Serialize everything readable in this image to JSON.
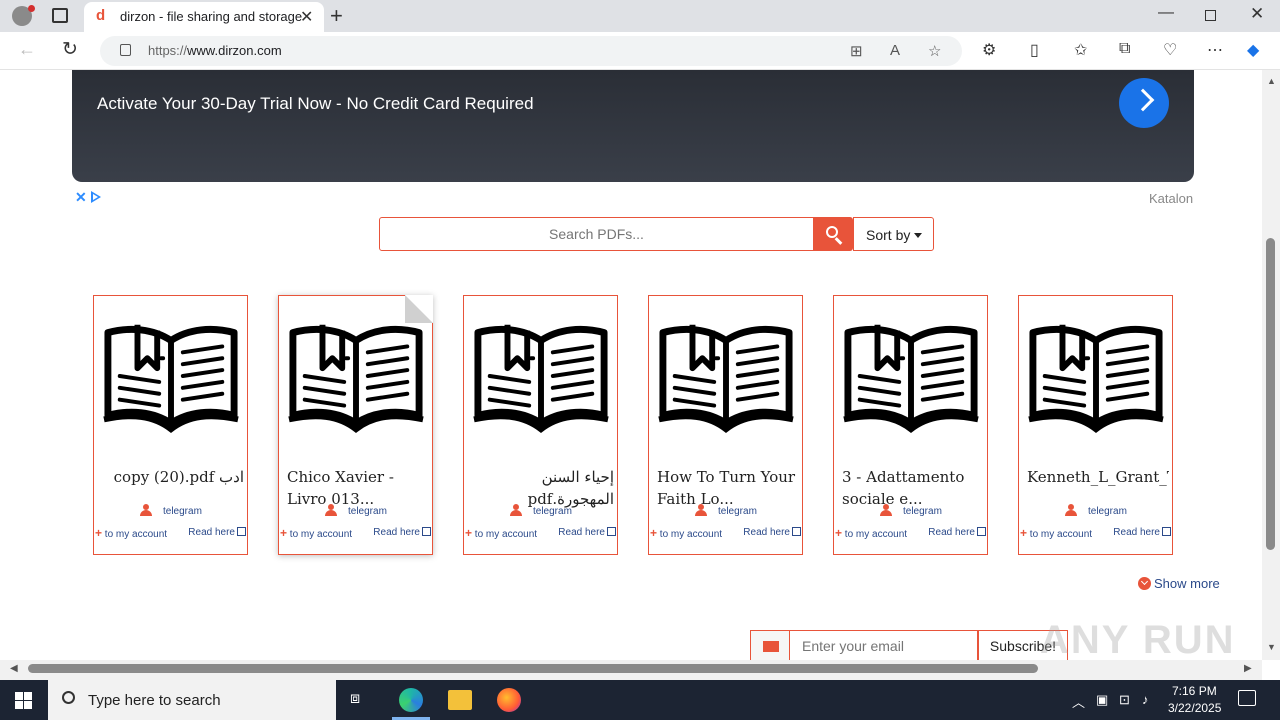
{
  "browser": {
    "tab_title": "dirzon - file sharing and storage",
    "favicon_letter": "d",
    "url_prefix": "https://",
    "url_host": "www.dirzon.com"
  },
  "ad": {
    "text": "Activate Your 30-Day Trial Now - No Credit Card Required",
    "brand": "Katalon",
    "close_glyph": "✕"
  },
  "search": {
    "placeholder": "Search PDFs...",
    "sort_label": "Sort by"
  },
  "cards": [
    {
      "title": "ادب copy (20).pdf",
      "author": "telegram",
      "add_label": "to my account",
      "read_label": "Read here"
    },
    {
      "title": "Chico Xavier - Livro 013...",
      "author": "telegram",
      "add_label": "to my account",
      "read_label": "Read here"
    },
    {
      "title": "إحياء السنن المهجورة.pdf",
      "author": "telegram",
      "add_label": "to my account",
      "read_label": "Read here"
    },
    {
      "title": "How To Turn Your Faith Lo...",
      "author": "telegram",
      "add_label": "to my account",
      "read_label": "Read here"
    },
    {
      "title": "3 - Adattamento sociale e...",
      "author": "telegram",
      "add_label": "to my account",
      "read_label": "Read here"
    },
    {
      "title": "Kenneth_L_Grant_Trading_R...",
      "author": "telegram",
      "add_label": "to my account",
      "read_label": "Read here"
    }
  ],
  "show_more": "Show more",
  "subscribe": {
    "placeholder": "Enter your email",
    "button": "Subscribe!"
  },
  "watermark": "ANY RUN",
  "taskbar": {
    "search_text": "Type here to search",
    "time": "7:16 PM",
    "date": "3/22/2025"
  },
  "colors": {
    "accent": "#e8543a",
    "link": "#2b4a8a",
    "ad_cta": "#1a73e8"
  }
}
